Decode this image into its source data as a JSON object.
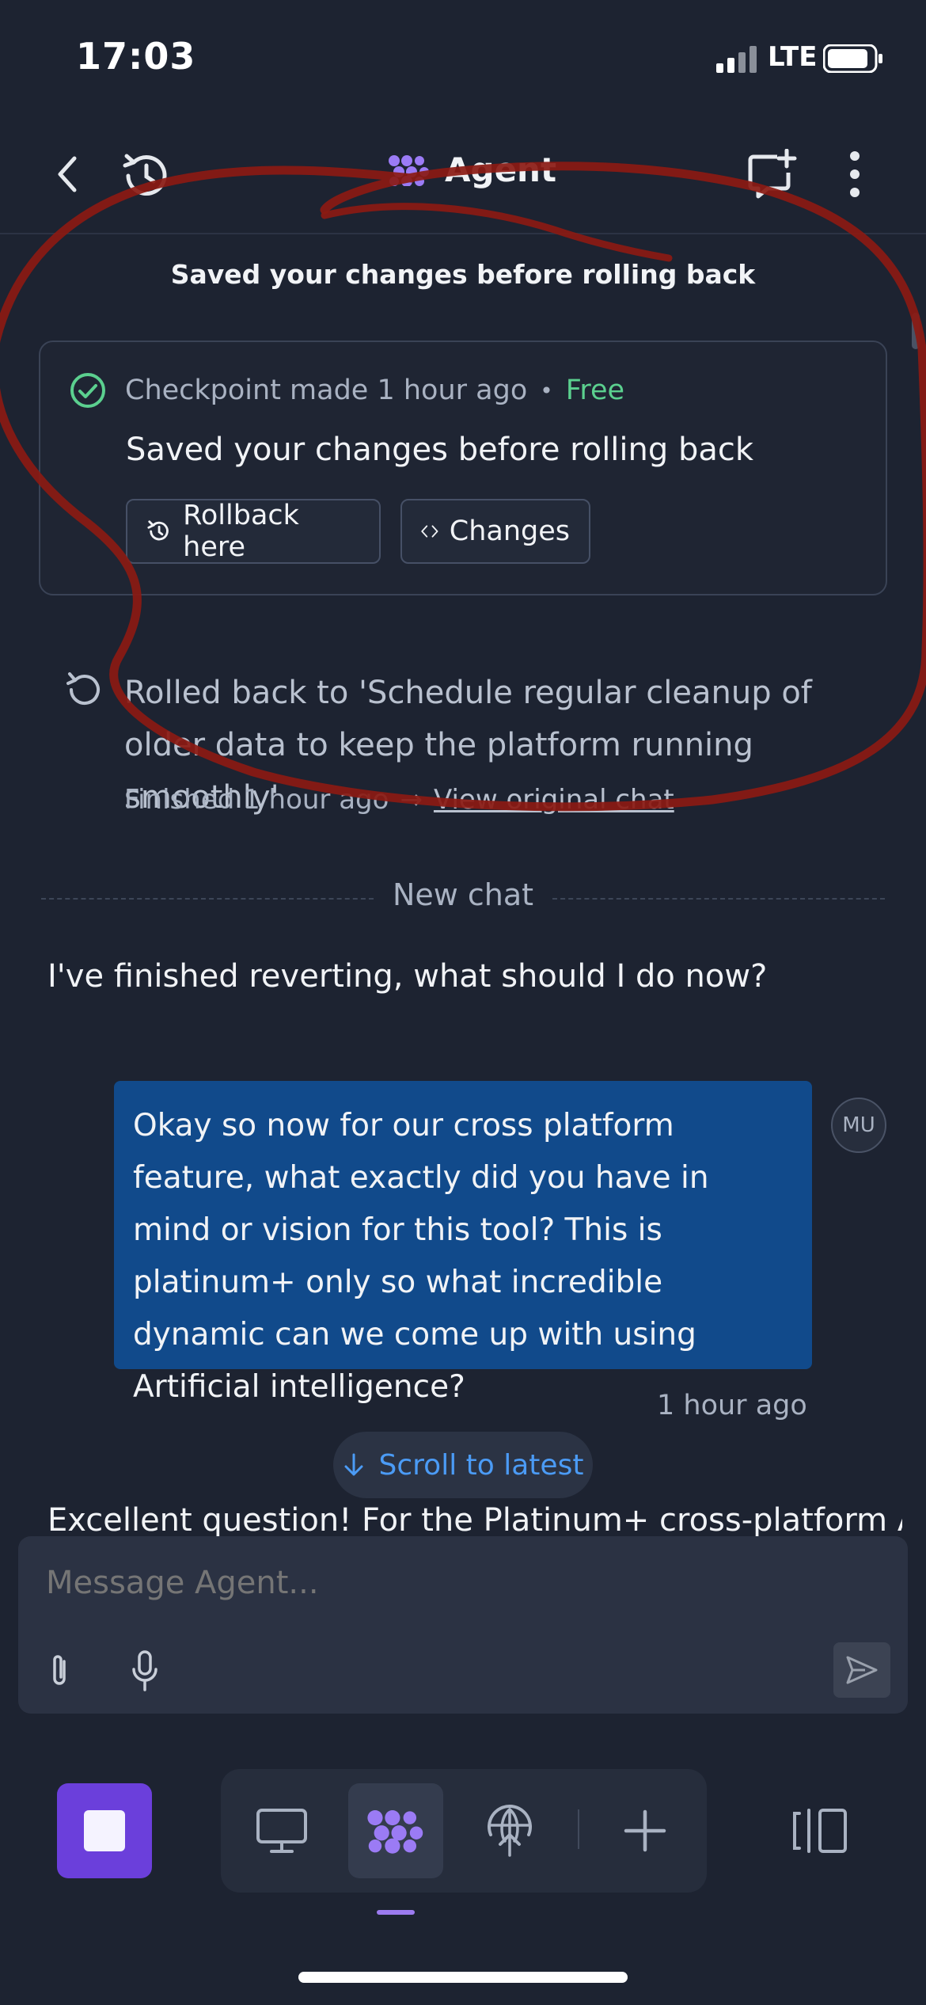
{
  "status_bar": {
    "time": "17:03",
    "network": "LTE"
  },
  "header": {
    "title": "Agent"
  },
  "checkpoint_notice": "Saved your changes before rolling back",
  "checkpoint": {
    "meta": "Checkpoint made 1 hour ago",
    "separator": "•",
    "price": "Free",
    "title": "Saved your changes before rolling back",
    "rollback_label": "Rollback here",
    "changes_label": "Changes"
  },
  "rollback": {
    "text": "Rolled back to 'Schedule regular cleanup of older data to keep the platform running smoothly'",
    "finished": "Finished 1 hour ago",
    "arrow": "→",
    "view_link": "View original chat"
  },
  "new_chat_label": "New chat",
  "agent_message": "I've finished reverting, what should I do now?",
  "user_message": {
    "text": "Okay so now for our cross platform feature, what exactly did you have in mind or vision for this tool? This is platinum+ only so what incredible dynamic can we come up with using Artificial intelligence?",
    "avatar": "MU",
    "time": "1 hour ago"
  },
  "scroll_latest_label": "Scroll to latest",
  "agent_reply_preview": "Excellent question! For the Platinum+ cross-platform AI",
  "composer": {
    "placeholder": "Message Agent..."
  },
  "colors": {
    "background": "#1d2331",
    "user_bubble": "#114a8b",
    "accent_purple": "#6b3fdb",
    "link_blue": "#4b9bf5",
    "free_green": "#5bd08f",
    "annotation_red": "#8b1a12"
  },
  "icons": [
    "back-icon",
    "history-icon",
    "agent-logo-icon",
    "new-chat-icon",
    "more-icon",
    "check-circle-icon",
    "history-small-icon",
    "code-icon",
    "undo-icon",
    "arrow-down-icon",
    "paperclip-icon",
    "mic-icon",
    "send-icon",
    "stop-icon",
    "desktop-icon",
    "agent-icon",
    "deploy-icon",
    "plus-icon",
    "panels-icon"
  ]
}
